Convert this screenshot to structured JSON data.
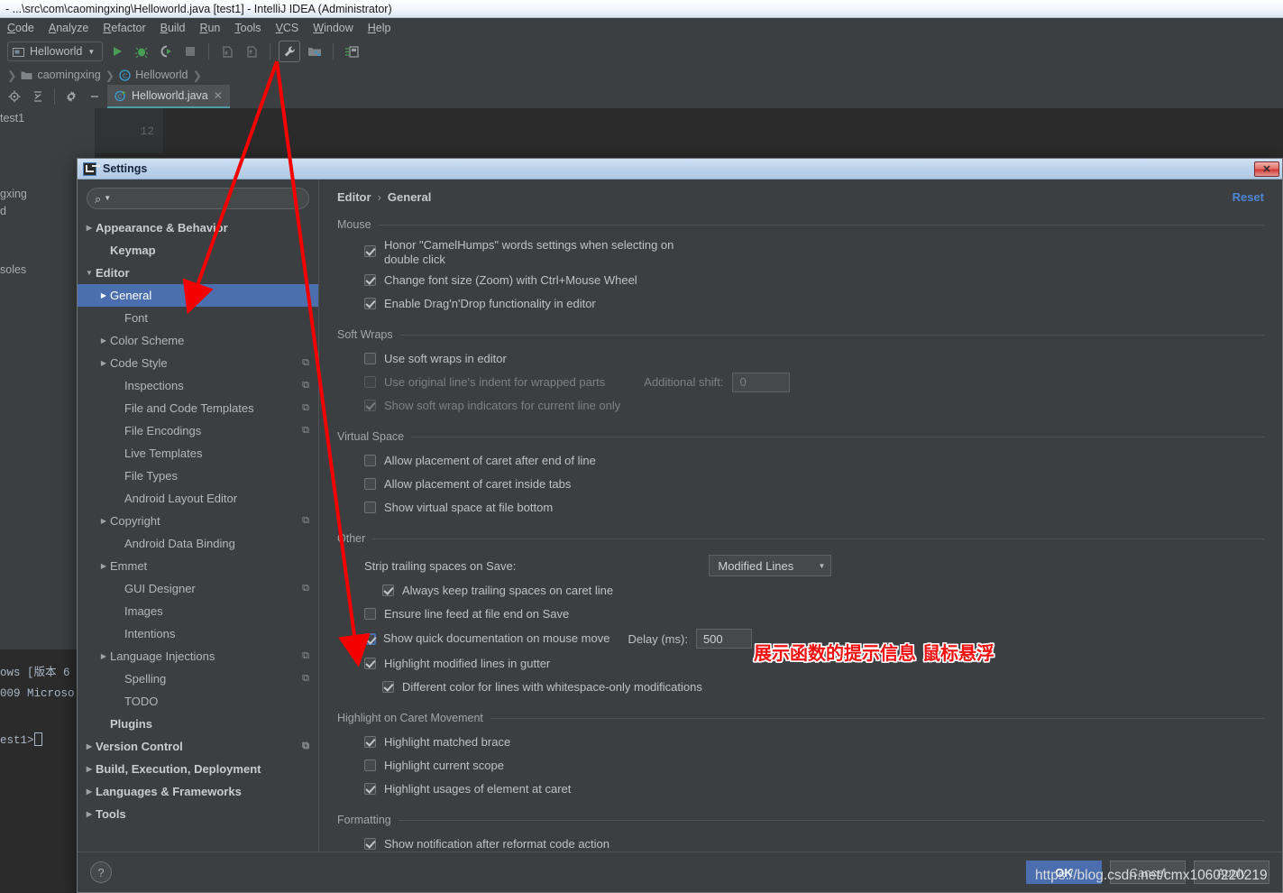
{
  "ide": {
    "title": "- ...\\src\\com\\caomingxing\\Helloworld.java [test1] - IntelliJ IDEA (Administrator)",
    "menu": [
      "Code",
      "Analyze",
      "Refactor",
      "Build",
      "Run",
      "Tools",
      "VCS",
      "Window",
      "Help"
    ],
    "run_config": "Helloworld",
    "breadcrumb": [
      "caomingxing",
      "Helloworld"
    ],
    "file_tab": "Helloworld.java",
    "line_number": "12",
    "project_items": [
      "test1",
      "gxing",
      "d",
      "soles"
    ],
    "terminal_lines": [
      "ows [版本 6",
      "009 Microso",
      "est1>"
    ]
  },
  "dialog": {
    "title": "Settings",
    "close_label": "✕",
    "search_placeholder": "",
    "search_value": "",
    "reset_label": "Reset",
    "breadcrumb": {
      "parent": "Editor",
      "sep": "›",
      "current": "General"
    },
    "sidebar": [
      {
        "label": "Appearance & Behavior",
        "indent": 0,
        "arrow": "right",
        "bold": true,
        "copy": false,
        "selected": false
      },
      {
        "label": "Keymap",
        "indent": 1,
        "arrow": "none",
        "bold": true,
        "copy": false,
        "selected": false
      },
      {
        "label": "Editor",
        "indent": 0,
        "arrow": "down",
        "bold": true,
        "copy": false,
        "selected": false
      },
      {
        "label": "General",
        "indent": 1,
        "arrow": "right",
        "bold": false,
        "copy": false,
        "selected": true
      },
      {
        "label": "Font",
        "indent": 2,
        "arrow": "none",
        "bold": false,
        "copy": false,
        "selected": false
      },
      {
        "label": "Color Scheme",
        "indent": 1,
        "arrow": "right",
        "bold": false,
        "copy": false,
        "selected": false
      },
      {
        "label": "Code Style",
        "indent": 1,
        "arrow": "right",
        "bold": false,
        "copy": true,
        "selected": false
      },
      {
        "label": "Inspections",
        "indent": 2,
        "arrow": "none",
        "bold": false,
        "copy": true,
        "selected": false
      },
      {
        "label": "File and Code Templates",
        "indent": 2,
        "arrow": "none",
        "bold": false,
        "copy": true,
        "selected": false
      },
      {
        "label": "File Encodings",
        "indent": 2,
        "arrow": "none",
        "bold": false,
        "copy": true,
        "selected": false
      },
      {
        "label": "Live Templates",
        "indent": 2,
        "arrow": "none",
        "bold": false,
        "copy": false,
        "selected": false
      },
      {
        "label": "File Types",
        "indent": 2,
        "arrow": "none",
        "bold": false,
        "copy": false,
        "selected": false
      },
      {
        "label": "Android Layout Editor",
        "indent": 2,
        "arrow": "none",
        "bold": false,
        "copy": false,
        "selected": false
      },
      {
        "label": "Copyright",
        "indent": 1,
        "arrow": "right",
        "bold": false,
        "copy": true,
        "selected": false
      },
      {
        "label": "Android Data Binding",
        "indent": 2,
        "arrow": "none",
        "bold": false,
        "copy": false,
        "selected": false
      },
      {
        "label": "Emmet",
        "indent": 1,
        "arrow": "right",
        "bold": false,
        "copy": false,
        "selected": false
      },
      {
        "label": "GUI Designer",
        "indent": 2,
        "arrow": "none",
        "bold": false,
        "copy": true,
        "selected": false
      },
      {
        "label": "Images",
        "indent": 2,
        "arrow": "none",
        "bold": false,
        "copy": false,
        "selected": false
      },
      {
        "label": "Intentions",
        "indent": 2,
        "arrow": "none",
        "bold": false,
        "copy": false,
        "selected": false
      },
      {
        "label": "Language Injections",
        "indent": 1,
        "arrow": "right",
        "bold": false,
        "copy": true,
        "selected": false
      },
      {
        "label": "Spelling",
        "indent": 2,
        "arrow": "none",
        "bold": false,
        "copy": true,
        "selected": false
      },
      {
        "label": "TODO",
        "indent": 2,
        "arrow": "none",
        "bold": false,
        "copy": false,
        "selected": false
      },
      {
        "label": "Plugins",
        "indent": 1,
        "arrow": "none",
        "bold": true,
        "copy": false,
        "selected": false
      },
      {
        "label": "Version Control",
        "indent": 0,
        "arrow": "right",
        "bold": true,
        "copy": true,
        "selected": false
      },
      {
        "label": "Build, Execution, Deployment",
        "indent": 0,
        "arrow": "right",
        "bold": true,
        "copy": false,
        "selected": false
      },
      {
        "label": "Languages & Frameworks",
        "indent": 0,
        "arrow": "right",
        "bold": true,
        "copy": false,
        "selected": false
      },
      {
        "label": "Tools",
        "indent": 0,
        "arrow": "right",
        "bold": true,
        "copy": false,
        "selected": false
      }
    ],
    "groups": {
      "mouse": {
        "title": "Mouse",
        "items": [
          {
            "label": "Honor \"CamelHumps\" words settings when selecting on double click",
            "checked": true,
            "disabled": false
          },
          {
            "label": "Change font size (Zoom) with Ctrl+Mouse Wheel",
            "checked": true,
            "disabled": false
          },
          {
            "label": "Enable Drag'n'Drop functionality in editor",
            "checked": true,
            "disabled": false
          }
        ]
      },
      "soft_wraps": {
        "title": "Soft Wraps",
        "items": [
          {
            "label": "Use soft wraps in editor",
            "checked": false,
            "disabled": false
          },
          {
            "label": "Use original line's indent for wrapped parts",
            "checked": false,
            "disabled": true
          },
          {
            "label": "Show soft wrap indicators for current line only",
            "checked": true,
            "disabled": true
          }
        ],
        "additional_shift_label": "Additional shift:",
        "additional_shift_value": "0"
      },
      "virtual_space": {
        "title": "Virtual Space",
        "items": [
          {
            "label": "Allow placement of caret after end of line",
            "checked": false,
            "disabled": false
          },
          {
            "label": "Allow placement of caret inside tabs",
            "checked": false,
            "disabled": false
          },
          {
            "label": "Show virtual space at file bottom",
            "checked": false,
            "disabled": false
          }
        ]
      },
      "other": {
        "title": "Other",
        "strip_label": "Strip trailing spaces on Save:",
        "strip_value": "Modified Lines",
        "items": [
          {
            "label": "Always keep trailing spaces on caret line",
            "checked": true,
            "disabled": false,
            "indent": 2
          },
          {
            "label": "Ensure line feed at file end on Save",
            "checked": false,
            "disabled": false,
            "indent": 1
          },
          {
            "label": "Show quick documentation on mouse move",
            "checked": true,
            "disabled": false,
            "indent": 1,
            "focused": true
          },
          {
            "label": "Highlight modified lines in gutter",
            "checked": true,
            "disabled": false,
            "indent": 1
          },
          {
            "label": "Different color for lines with whitespace-only modifications",
            "checked": true,
            "disabled": false,
            "indent": 2
          }
        ],
        "delay_label": "Delay (ms):",
        "delay_value": "500"
      },
      "highlight_caret": {
        "title": "Highlight on Caret Movement",
        "items": [
          {
            "label": "Highlight matched brace",
            "checked": true,
            "disabled": false
          },
          {
            "label": "Highlight current scope",
            "checked": false,
            "disabled": false
          },
          {
            "label": "Highlight usages of element at caret",
            "checked": true,
            "disabled": false
          }
        ]
      },
      "formatting": {
        "title": "Formatting",
        "items": [
          {
            "label": "Show notification after reformat code action",
            "checked": true,
            "disabled": false
          }
        ]
      }
    },
    "footer": {
      "help_label": "?",
      "ok_label": "OK",
      "cancel_label": "Cancel",
      "apply_label": "Apply"
    }
  },
  "annotations": {
    "chinese_note": "展示函数的提示信息 鼠标悬浮",
    "watermark": "https://blog.csdn.net/cmx1060220219",
    "arrow_color": "#f40000"
  },
  "colors": {
    "accent_selection": "#4b6eaf",
    "link": "#4d86d4",
    "panel_bg": "#3c3f41",
    "editor_bg": "#2b2b2b",
    "annotation_red": "#f01010"
  }
}
